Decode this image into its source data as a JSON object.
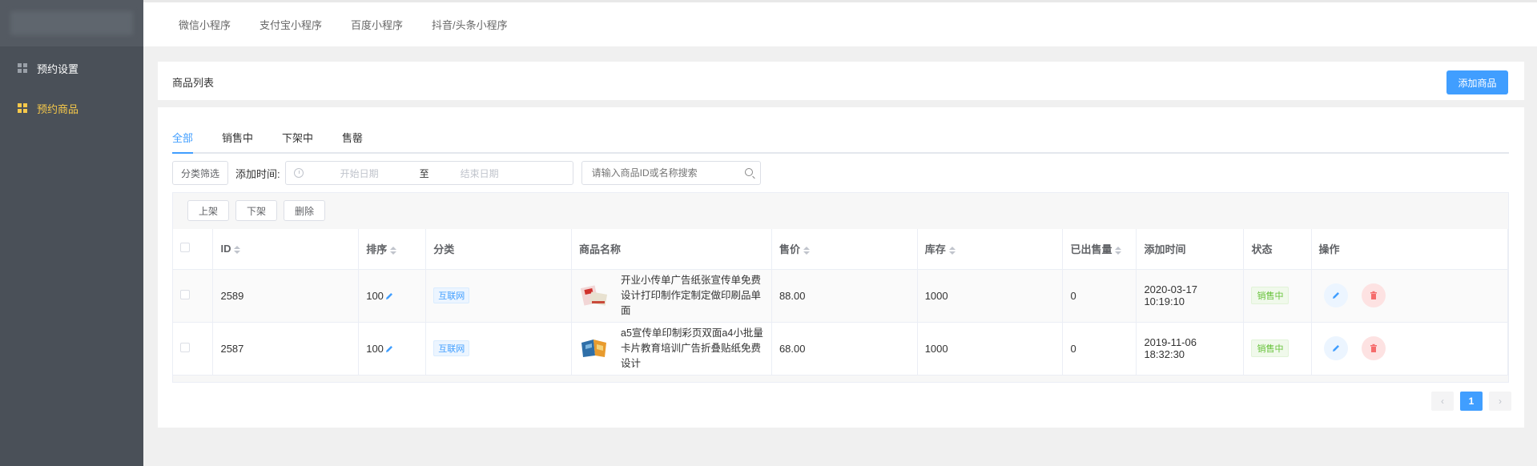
{
  "top_tabs": [
    "微信小程序",
    "支付宝小程序",
    "百度小程序",
    "抖音/头条小程序"
  ],
  "sidebar": {
    "items": [
      {
        "label": "预约设置",
        "active": false
      },
      {
        "label": "预约商品",
        "active": true
      }
    ]
  },
  "header": {
    "title": "商品列表",
    "add_button": "添加商品"
  },
  "status_tabs": [
    "全部",
    "销售中",
    "下架中",
    "售罄"
  ],
  "filter": {
    "category_button": "分类筛选",
    "time_label": "添加时间:",
    "start_placeholder": "开始日期",
    "separator": "至",
    "end_placeholder": "结束日期",
    "search_placeholder": "请输入商品ID或名称搜索"
  },
  "bulk_actions": [
    "上架",
    "下架",
    "删除"
  ],
  "table": {
    "headers": [
      "ID",
      "排序",
      "分类",
      "商品名称",
      "售价",
      "库存",
      "已出售量",
      "添加时间",
      "状态",
      "操作"
    ],
    "rows": [
      {
        "id": "2589",
        "sort": "100",
        "category": "互联网",
        "name": "开业小传单广告纸张宣传单免费设计打印制作定制定做印刷品单面",
        "price": "88.00",
        "stock": "1000",
        "sold": "0",
        "added": "2020-03-17 10:19:10",
        "status": "销售中"
      },
      {
        "id": "2587",
        "sort": "100",
        "category": "互联网",
        "name": "a5宣传单印制彩页双面a4小批量卡片教育培训广告折叠贴纸免费设计",
        "price": "68.00",
        "stock": "1000",
        "sold": "0",
        "added": "2019-11-06 18:32:30",
        "status": "销售中"
      }
    ]
  },
  "pagination": {
    "current": "1",
    "prev": "‹",
    "next": "›"
  },
  "colors": {
    "primary": "#409eff",
    "sidebar": "#4a5058",
    "active_menu": "#f7c94a",
    "success": "#67c23a",
    "danger": "#f56c6c"
  }
}
